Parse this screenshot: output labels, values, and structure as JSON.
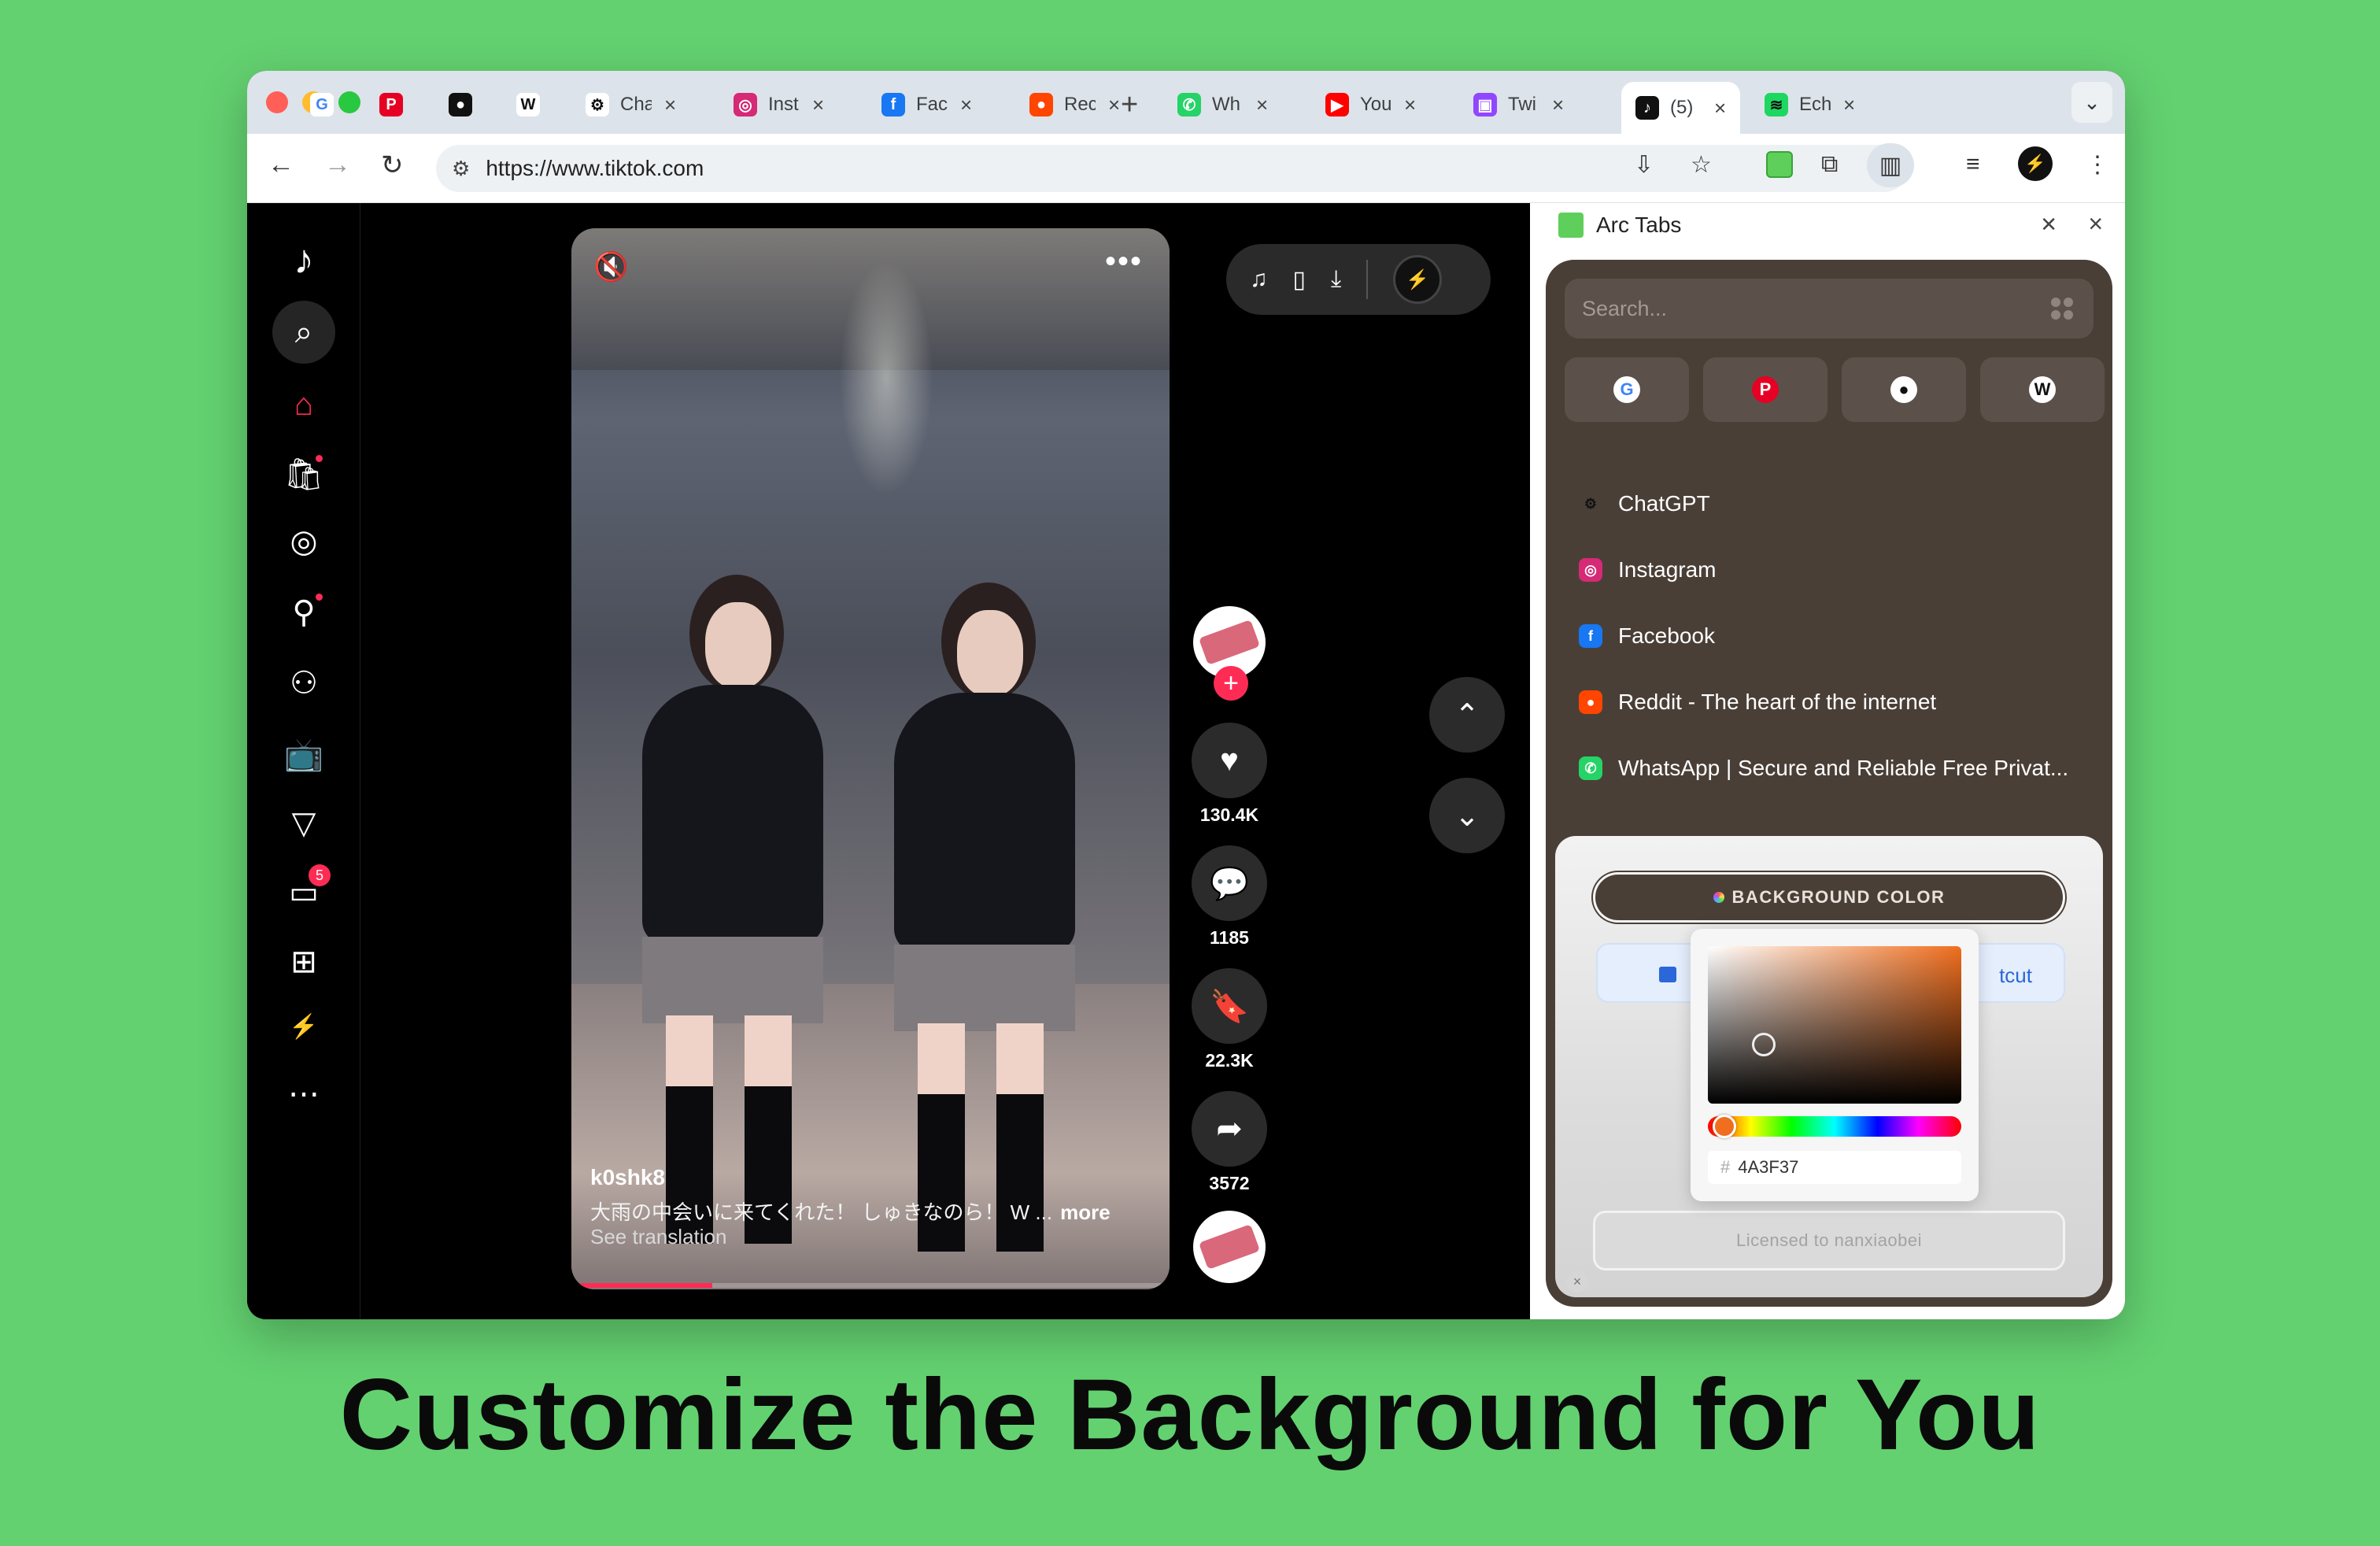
{
  "browser": {
    "tabs": [
      {
        "title": "",
        "icon": "google-icon",
        "color": "#ffffff",
        "glyph": "G",
        "glyph_color": "#4285f4"
      },
      {
        "title": "",
        "icon": "pinterest-icon",
        "color": "#e60023",
        "glyph": "P",
        "glyph_color": "#ffffff"
      },
      {
        "title": "",
        "icon": "apple-icon",
        "color": "#111111",
        "glyph": "●",
        "glyph_color": "#ffffff"
      },
      {
        "title": "",
        "icon": "wikipedia-icon",
        "color": "#ffffff",
        "glyph": "W",
        "glyph_color": "#111111"
      },
      {
        "title": "Cha",
        "icon": "chatgpt-icon",
        "color": "#ffffff",
        "glyph": "⚙",
        "glyph_color": "#111111"
      },
      {
        "title": "Inst",
        "icon": "instagram-icon",
        "color": "#d62976",
        "glyph": "◎",
        "glyph_color": "#ffffff"
      },
      {
        "title": "Fac",
        "icon": "facebook-icon",
        "color": "#1877f2",
        "glyph": "f",
        "glyph_color": "#ffffff"
      },
      {
        "title": "Rec",
        "icon": "reddit-icon",
        "color": "#ff4500",
        "glyph": "●",
        "glyph_color": "#ffffff"
      },
      {
        "title": "Wh",
        "icon": "whatsapp-icon",
        "color": "#25d366",
        "glyph": "✆",
        "glyph_color": "#ffffff"
      },
      {
        "title": "You",
        "icon": "youtube-icon",
        "color": "#ff0000",
        "glyph": "▶",
        "glyph_color": "#ffffff"
      },
      {
        "title": "Twi",
        "icon": "twitch-icon",
        "color": "#9146ff",
        "glyph": "▣",
        "glyph_color": "#ffffff"
      },
      {
        "title": "(5)",
        "icon": "tiktok-icon",
        "color": "#111111",
        "glyph": "♪",
        "glyph_color": "#ffffff"
      },
      {
        "title": "Ech",
        "icon": "spotify-icon",
        "color": "#1ed760",
        "glyph": "≋",
        "glyph_color": "#111111"
      }
    ],
    "url": "https://www.tiktok.com"
  },
  "tiktok": {
    "author": "k0shk8",
    "caption": "大雨の中会いに来てくれた！ しゅきなのら！ W ...",
    "more": "more",
    "see_translation": "See translation",
    "progress": 0.23,
    "likes": "130.4K",
    "comments": "1185",
    "saves": "22.3K",
    "shares": "3572",
    "messages_badge": "5"
  },
  "side_panel": {
    "title": "Arc Tabs",
    "search_placeholder": "Search...",
    "pinned": [
      {
        "icon": "google-icon",
        "glyph": "G",
        "bg": "#ffffff",
        "fg": "#4285f4"
      },
      {
        "icon": "pinterest-icon",
        "glyph": "P",
        "bg": "#e60023",
        "fg": "#ffffff"
      },
      {
        "icon": "apple-icon",
        "glyph": "●",
        "bg": "#ffffff",
        "fg": "#111111"
      },
      {
        "icon": "wikipedia-icon",
        "glyph": "W",
        "bg": "#ffffff",
        "fg": "#111111"
      }
    ],
    "list": [
      {
        "label": "ChatGPT",
        "icon": "chatgpt-icon",
        "glyph": "⚙",
        "bg": "#4a3f37",
        "fg": "#111111"
      },
      {
        "label": "Instagram",
        "icon": "instagram-icon",
        "glyph": "◎",
        "bg": "#d62976",
        "fg": "#ffffff"
      },
      {
        "label": "Facebook",
        "icon": "facebook-icon",
        "glyph": "f",
        "bg": "#1877f2",
        "fg": "#ffffff"
      },
      {
        "label": "Reddit - The heart of the internet",
        "icon": "reddit-icon",
        "glyph": "●",
        "bg": "#ff4500",
        "fg": "#ffffff"
      },
      {
        "label": "WhatsApp | Secure and Reliable Free Privat...",
        "icon": "whatsapp-icon",
        "glyph": "✆",
        "bg": "#25d366",
        "fg": "#ffffff"
      }
    ],
    "settings": {
      "background_color_label": "BACKGROUND COLOR",
      "shortcut_label": "tcut",
      "license": "Licensed to nanxiaobei",
      "hex_value": "4A3F37",
      "hue_color": "#f06e1e",
      "panel_bg": "#4a3f37"
    }
  },
  "headline": "Customize the Background for You"
}
